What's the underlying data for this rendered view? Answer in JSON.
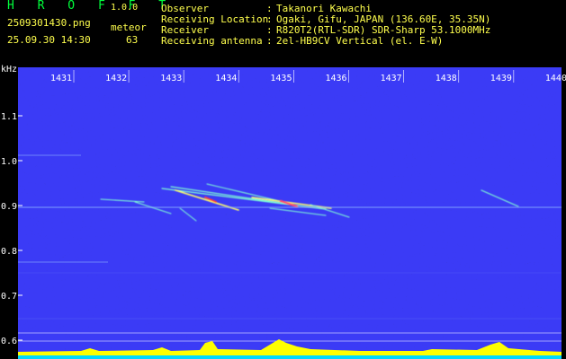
{
  "app": {
    "name": "H R O F F T",
    "version": "1.0.0"
  },
  "file": {
    "name": "2509301430.png",
    "type": "meteor",
    "datetime": "25.09.30 14:30",
    "count": "63"
  },
  "info": [
    {
      "label": "Observer",
      "sep": ":",
      "value": "Takanori Kawachi"
    },
    {
      "label": "Receiving Location",
      "sep": ":",
      "value": "Ogaki, Gifu, JAPAN (136.60E, 35.35N)"
    },
    {
      "label": "Receiver",
      "sep": ":",
      "value": "R820T2(RTL-SDR) SDR-Sharp 53.1000MHz"
    },
    {
      "label": "Receiving antenna",
      "sep": ":",
      "value": "2el-HB9CV Vertical (el. E-W)"
    }
  ],
  "axis": {
    "unit": "kHz",
    "y_ticks": [
      "1.1",
      "1.0",
      "0.9",
      "0.8",
      "0.7",
      "0.6"
    ],
    "x_ticks": [
      "1431",
      "1432",
      "1433",
      "1434",
      "1435",
      "1436",
      "1437",
      "1438",
      "1439",
      "1440"
    ]
  },
  "colors": {
    "background": "#000000",
    "header_green": "#00ff3c",
    "header_yellow": "#ffff4d",
    "spectrum_base": "#1a1aa8",
    "level_bar": "#ffff00",
    "baseline": "#00e5ff"
  }
}
